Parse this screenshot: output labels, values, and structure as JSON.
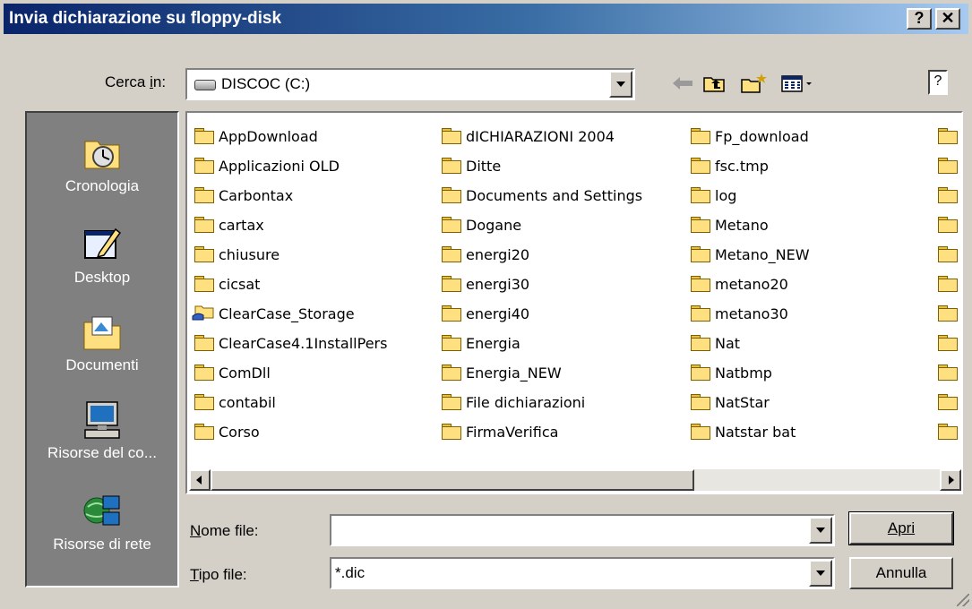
{
  "window": {
    "title": "Invia dichiarazione su floppy-disk",
    "help_button": "?",
    "close_button": "✕"
  },
  "toolbar": {
    "look_in_label": "Cerca in:",
    "look_in_underline": "i",
    "look_in_value": "DISCOC (C:)",
    "icons": [
      "back-arrow-icon",
      "up-folder-icon",
      "new-folder-icon",
      "view-menu-icon",
      "help-icon"
    ],
    "help_text": "?"
  },
  "places": [
    {
      "label": "Cronologia",
      "icon": "history-icon"
    },
    {
      "label": "Desktop",
      "icon": "desktop-icon"
    },
    {
      "label": "Documenti",
      "icon": "documents-icon"
    },
    {
      "label": "Risorse del co...",
      "icon": "my-computer-icon"
    },
    {
      "label": "Risorse di rete",
      "icon": "network-icon"
    }
  ],
  "files": {
    "columns": [
      [
        "AppDownload",
        "Applicazioni OLD",
        "Carbontax",
        "cartax",
        "chiusure",
        "cicsat",
        "ClearCase_Storage",
        "ClearCase4.1InstallPers",
        "ComDll",
        "contabil",
        "Corso"
      ],
      [
        "dICHIARAZIONI 2004",
        "Ditte",
        "Documents and Settings",
        "Dogane",
        "energi20",
        "energi30",
        "energi40",
        "Energia",
        "Energia_NEW",
        "File dichiarazioni",
        "FirmaVerifica"
      ],
      [
        "Fp_download",
        "fsc.tmp",
        "log",
        "Metano",
        "Metano_NEW",
        "metano20",
        "metano30",
        "Nat",
        "Natbmp",
        "NatStar",
        "Natstar bat"
      ]
    ],
    "shared_folder": "ClearCase_Storage"
  },
  "form": {
    "filename_label": "Nome file:",
    "filename_value": "",
    "filetype_label": "Tipo file:",
    "filetype_value": "*.dic"
  },
  "buttons": {
    "open": "Apri",
    "cancel": "Annulla"
  },
  "colors": {
    "titlebar_start": "#0a246a",
    "titlebar_end": "#a6caf0",
    "face": "#d4d0c8",
    "places_bg": "#808080",
    "folder": "#ffe080"
  }
}
